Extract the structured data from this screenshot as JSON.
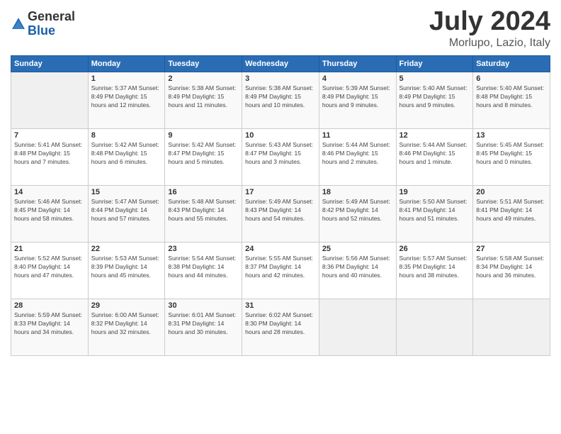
{
  "header": {
    "logo_general": "General",
    "logo_blue": "Blue",
    "month_title": "July 2024",
    "location": "Morlupo, Lazio, Italy"
  },
  "days_of_week": [
    "Sunday",
    "Monday",
    "Tuesday",
    "Wednesday",
    "Thursday",
    "Friday",
    "Saturday"
  ],
  "weeks": [
    [
      {
        "day": "",
        "info": ""
      },
      {
        "day": "1",
        "info": "Sunrise: 5:37 AM\nSunset: 8:49 PM\nDaylight: 15 hours\nand 12 minutes."
      },
      {
        "day": "2",
        "info": "Sunrise: 5:38 AM\nSunset: 8:49 PM\nDaylight: 15 hours\nand 11 minutes."
      },
      {
        "day": "3",
        "info": "Sunrise: 5:38 AM\nSunset: 8:49 PM\nDaylight: 15 hours\nand 10 minutes."
      },
      {
        "day": "4",
        "info": "Sunrise: 5:39 AM\nSunset: 8:49 PM\nDaylight: 15 hours\nand 9 minutes."
      },
      {
        "day": "5",
        "info": "Sunrise: 5:40 AM\nSunset: 8:49 PM\nDaylight: 15 hours\nand 9 minutes."
      },
      {
        "day": "6",
        "info": "Sunrise: 5:40 AM\nSunset: 8:48 PM\nDaylight: 15 hours\nand 8 minutes."
      }
    ],
    [
      {
        "day": "7",
        "info": "Sunrise: 5:41 AM\nSunset: 8:48 PM\nDaylight: 15 hours\nand 7 minutes."
      },
      {
        "day": "8",
        "info": "Sunrise: 5:42 AM\nSunset: 8:48 PM\nDaylight: 15 hours\nand 6 minutes."
      },
      {
        "day": "9",
        "info": "Sunrise: 5:42 AM\nSunset: 8:47 PM\nDaylight: 15 hours\nand 5 minutes."
      },
      {
        "day": "10",
        "info": "Sunrise: 5:43 AM\nSunset: 8:47 PM\nDaylight: 15 hours\nand 3 minutes."
      },
      {
        "day": "11",
        "info": "Sunrise: 5:44 AM\nSunset: 8:46 PM\nDaylight: 15 hours\nand 2 minutes."
      },
      {
        "day": "12",
        "info": "Sunrise: 5:44 AM\nSunset: 8:46 PM\nDaylight: 15 hours\nand 1 minute."
      },
      {
        "day": "13",
        "info": "Sunrise: 5:45 AM\nSunset: 8:45 PM\nDaylight: 15 hours\nand 0 minutes."
      }
    ],
    [
      {
        "day": "14",
        "info": "Sunrise: 5:46 AM\nSunset: 8:45 PM\nDaylight: 14 hours\nand 58 minutes."
      },
      {
        "day": "15",
        "info": "Sunrise: 5:47 AM\nSunset: 8:44 PM\nDaylight: 14 hours\nand 57 minutes."
      },
      {
        "day": "16",
        "info": "Sunrise: 5:48 AM\nSunset: 8:43 PM\nDaylight: 14 hours\nand 55 minutes."
      },
      {
        "day": "17",
        "info": "Sunrise: 5:49 AM\nSunset: 8:43 PM\nDaylight: 14 hours\nand 54 minutes."
      },
      {
        "day": "18",
        "info": "Sunrise: 5:49 AM\nSunset: 8:42 PM\nDaylight: 14 hours\nand 52 minutes."
      },
      {
        "day": "19",
        "info": "Sunrise: 5:50 AM\nSunset: 8:41 PM\nDaylight: 14 hours\nand 51 minutes."
      },
      {
        "day": "20",
        "info": "Sunrise: 5:51 AM\nSunset: 8:41 PM\nDaylight: 14 hours\nand 49 minutes."
      }
    ],
    [
      {
        "day": "21",
        "info": "Sunrise: 5:52 AM\nSunset: 8:40 PM\nDaylight: 14 hours\nand 47 minutes."
      },
      {
        "day": "22",
        "info": "Sunrise: 5:53 AM\nSunset: 8:39 PM\nDaylight: 14 hours\nand 45 minutes."
      },
      {
        "day": "23",
        "info": "Sunrise: 5:54 AM\nSunset: 8:38 PM\nDaylight: 14 hours\nand 44 minutes."
      },
      {
        "day": "24",
        "info": "Sunrise: 5:55 AM\nSunset: 8:37 PM\nDaylight: 14 hours\nand 42 minutes."
      },
      {
        "day": "25",
        "info": "Sunrise: 5:56 AM\nSunset: 8:36 PM\nDaylight: 14 hours\nand 40 minutes."
      },
      {
        "day": "26",
        "info": "Sunrise: 5:57 AM\nSunset: 8:35 PM\nDaylight: 14 hours\nand 38 minutes."
      },
      {
        "day": "27",
        "info": "Sunrise: 5:58 AM\nSunset: 8:34 PM\nDaylight: 14 hours\nand 36 minutes."
      }
    ],
    [
      {
        "day": "28",
        "info": "Sunrise: 5:59 AM\nSunset: 8:33 PM\nDaylight: 14 hours\nand 34 minutes."
      },
      {
        "day": "29",
        "info": "Sunrise: 6:00 AM\nSunset: 8:32 PM\nDaylight: 14 hours\nand 32 minutes."
      },
      {
        "day": "30",
        "info": "Sunrise: 6:01 AM\nSunset: 8:31 PM\nDaylight: 14 hours\nand 30 minutes."
      },
      {
        "day": "31",
        "info": "Sunrise: 6:02 AM\nSunset: 8:30 PM\nDaylight: 14 hours\nand 28 minutes."
      },
      {
        "day": "",
        "info": ""
      },
      {
        "day": "",
        "info": ""
      },
      {
        "day": "",
        "info": ""
      }
    ]
  ]
}
